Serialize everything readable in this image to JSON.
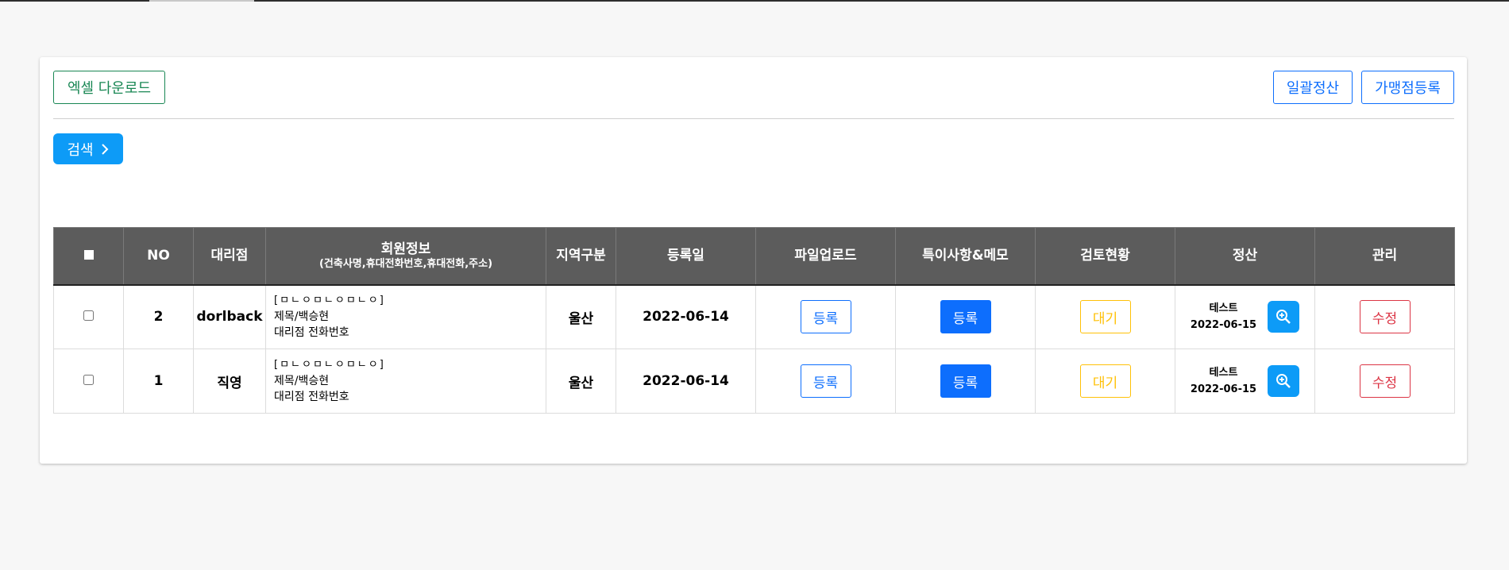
{
  "toolbar": {
    "excel_label": "엑셀 다운로드",
    "bulk_settle_label": "일괄정산",
    "store_register_label": "가맹점등록",
    "search_label": "검색"
  },
  "table": {
    "headers": {
      "no": "NO",
      "agency": "대리점",
      "member": "회원정보",
      "member_sub": "(건축사명,휴대전화번호,휴대전화,주소)",
      "region": "지역구분",
      "reg_date": "등록일",
      "file_upload": "파일업로드",
      "memo": "특이사항&메모",
      "review": "검토현황",
      "settle": "정산",
      "manage": "관리"
    },
    "rows": [
      {
        "no": "2",
        "agency": "dorlback",
        "info_line1": "[ㅁㄴㅇㅁㄴㅇㅁㄴㅇ]",
        "info_line2": "제목/백승현",
        "info_line3": "대리점 전화번호",
        "region": "울산",
        "reg_date": "2022-06-14",
        "file_btn": "등록",
        "memo_btn": "등록",
        "review_btn": "대기",
        "settle_name": "테스트",
        "settle_date": "2022-06-15",
        "edit_btn": "수정"
      },
      {
        "no": "1",
        "agency": "직영",
        "info_line1": "[ㅁㄴㅇㅁㄴㅇㅁㄴㅇ]",
        "info_line2": "제목/백승현",
        "info_line3": "대리점 전화번호",
        "region": "울산",
        "reg_date": "2022-06-14",
        "file_btn": "등록",
        "memo_btn": "등록",
        "review_btn": "대기",
        "settle_name": "테스트",
        "settle_date": "2022-06-15",
        "edit_btn": "수정"
      }
    ]
  },
  "icons": {
    "search_chevron": "chevron-right-icon",
    "zoom": "zoom-in-icon"
  },
  "colors": {
    "primary": "#0d6efd",
    "search_blue": "#0d9bf7",
    "success": "#198754",
    "warning": "#ffc107",
    "danger": "#dc3545",
    "header_bg": "#5c5c5c"
  }
}
